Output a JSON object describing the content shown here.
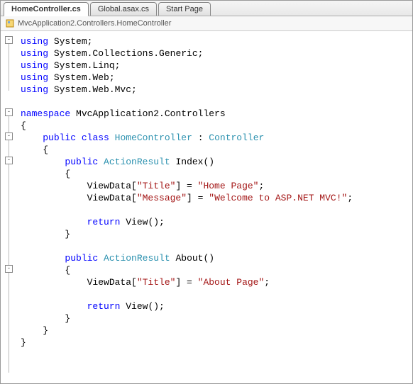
{
  "tabs": [
    {
      "label": "HomeController.cs",
      "active": true
    },
    {
      "label": "Global.asax.cs",
      "active": false
    },
    {
      "label": "Start Page",
      "active": false
    }
  ],
  "breadcrumb": "MvcApplication2.Controllers.HomeController",
  "code": {
    "usings": [
      {
        "kw": "using",
        "ns": "System"
      },
      {
        "kw": "using",
        "ns": "System.Collections.Generic"
      },
      {
        "kw": "using",
        "ns": "System.Linq"
      },
      {
        "kw": "using",
        "ns": "System.Web"
      },
      {
        "kw": "using",
        "ns": "System.Web.Mvc"
      }
    ],
    "namespace_kw": "namespace",
    "namespace": "MvcApplication2.Controllers",
    "class_mod": "public",
    "class_kw": "class",
    "class_name": "HomeController",
    "base_class": "Controller",
    "methods": [
      {
        "mod": "public",
        "ret": "ActionResult",
        "name": "Index",
        "body": [
          {
            "target": "ViewData",
            "key": "\"Title\"",
            "op": " = ",
            "val": "\"Home Page\""
          },
          {
            "target": "ViewData",
            "key": "\"Message\"",
            "op": " = ",
            "val": "\"Welcome to ASP.NET MVC!\""
          }
        ],
        "return_kw": "return",
        "return_call": "View()"
      },
      {
        "mod": "public",
        "ret": "ActionResult",
        "name": "About",
        "body": [
          {
            "target": "ViewData",
            "key": "\"Title\"",
            "op": " = ",
            "val": "\"About Page\""
          }
        ],
        "return_kw": "return",
        "return_call": "View()"
      }
    ]
  }
}
